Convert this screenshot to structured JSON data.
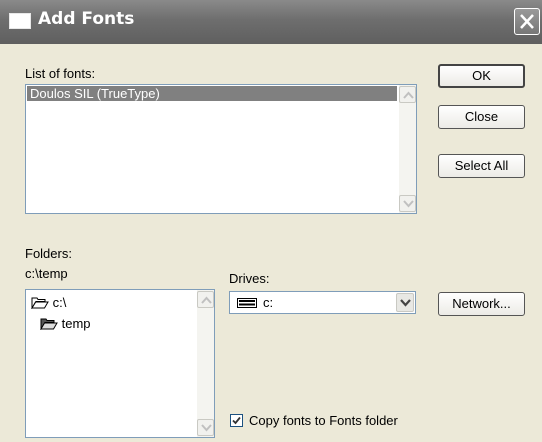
{
  "window": {
    "title": "Add Fonts"
  },
  "fonts_list": {
    "label": "List of fonts:",
    "items": [
      "Doulos SIL (TrueType)"
    ]
  },
  "buttons": {
    "ok": "OK",
    "close": "Close",
    "select_all": "Select All",
    "network": "Network..."
  },
  "folders": {
    "label": "Folders:",
    "current_path": "c:\\temp",
    "items": [
      "c:\\",
      "temp"
    ]
  },
  "drives": {
    "label": "Drives:",
    "selected": "c:"
  },
  "copy_option": {
    "label": "Copy fonts to Fonts folder",
    "checked": true
  },
  "colors": {
    "selection_bg": "#808080",
    "dialog_bg": "#ece9d8",
    "titlebar_bg": "#6e6e6e"
  }
}
